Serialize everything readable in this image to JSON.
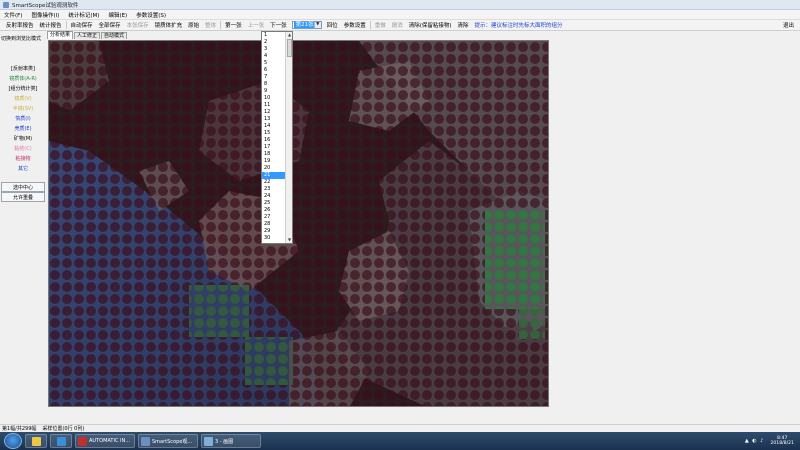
{
  "window": {
    "title": "SmartScope试验观测软件"
  },
  "menu": [
    "文件(F)",
    "图像操作(I)",
    "统计标记(M)",
    "编辑(E)",
    "参数设置(S)"
  ],
  "toolbar": {
    "items": [
      {
        "label": "反射率报告",
        "disabled": false
      },
      {
        "label": "统计报告",
        "disabled": false
      },
      {
        "sep": true
      },
      {
        "label": "自动保存",
        "disabled": false
      },
      {
        "label": "全部保存",
        "disabled": false
      },
      {
        "label": "本张保存",
        "disabled": true
      },
      {
        "label": "镜质体扩充",
        "disabled": false
      },
      {
        "label": "原始",
        "disabled": false
      },
      {
        "label": "整体",
        "disabled": true
      },
      {
        "sep": true
      },
      {
        "label": "第一张",
        "disabled": false
      },
      {
        "label": "上一张",
        "disabled": true
      },
      {
        "label": "下一张",
        "disabled": false
      }
    ],
    "combo_value": "第21张",
    "after": [
      {
        "label": "回位",
        "disabled": false
      },
      {
        "label": "参数设置",
        "disabled": false
      },
      {
        "sep": true
      },
      {
        "label": "重做",
        "disabled": true
      },
      {
        "label": "撤消",
        "disabled": true
      },
      {
        "label": "清除(保留粘接物)",
        "disabled": false
      },
      {
        "label": "清除",
        "disabled": false
      }
    ],
    "hint": "提示：建议标注时先标大面积的组分",
    "exit": "退出"
  },
  "sidebar": {
    "title": "切换到浏览比模式",
    "items": [
      {
        "label": "[反射率类]",
        "color": "#000000",
        "box": false
      },
      {
        "label": "镜质体(A-R)",
        "color": "#2e8b3e",
        "box": false
      },
      {
        "label": "[组分统计类]",
        "color": "#000000",
        "box": false
      },
      {
        "label": "镜质(V)",
        "color": "#c9b23a",
        "box": false
      },
      {
        "label": "半镜(SV)",
        "color": "#c9b23a",
        "box": false
      },
      {
        "label": "惰质(I)",
        "color": "#1a3fd0",
        "box": false
      },
      {
        "label": "壳质(E)",
        "color": "#1a3fd0",
        "box": false
      },
      {
        "label": "矿物(M)",
        "color": "#000000",
        "box": false
      },
      {
        "label": "黏结(C)",
        "color": "#e07aa0",
        "box": false
      },
      {
        "label": "粘接物",
        "color": "#c0306a",
        "box": false
      },
      {
        "label": "其它",
        "color": "#1a3fd0",
        "box": false
      },
      {
        "label": "选中中心",
        "color": "#000000",
        "box": true
      },
      {
        "label": "允许重叠",
        "color": "#000000",
        "box": true
      }
    ]
  },
  "tabs": [
    {
      "label": "分析结果",
      "active": true
    },
    {
      "label": "人工修正",
      "active": false
    },
    {
      "label": "自动模式",
      "active": false
    }
  ],
  "dropdown": {
    "options": [
      "1",
      "2",
      "3",
      "4",
      "5",
      "6",
      "7",
      "8",
      "9",
      "10",
      "11",
      "12",
      "13",
      "14",
      "15",
      "16",
      "17",
      "18",
      "19",
      "20",
      "21",
      "22",
      "23",
      "24",
      "25",
      "26",
      "27",
      "28",
      "29",
      "30"
    ],
    "highlighted": "21"
  },
  "status": {
    "left": "第1幅/共299幅",
    "right": "采样位置(0行 0列)"
  },
  "taskbar": {
    "items": [
      {
        "label": "",
        "color": "#e8c84a"
      },
      {
        "label": "",
        "color": "#3a8fd8"
      },
      {
        "label": "AUTOMATIC IN...",
        "color": "#c03030"
      },
      {
        "label": "SmartScope观...",
        "color": "#6a8fc2"
      },
      {
        "label": "3 - 画图",
        "color": "#7fb0d8"
      }
    ],
    "clock_time": "8:47",
    "clock_date": "2018/8/21"
  }
}
